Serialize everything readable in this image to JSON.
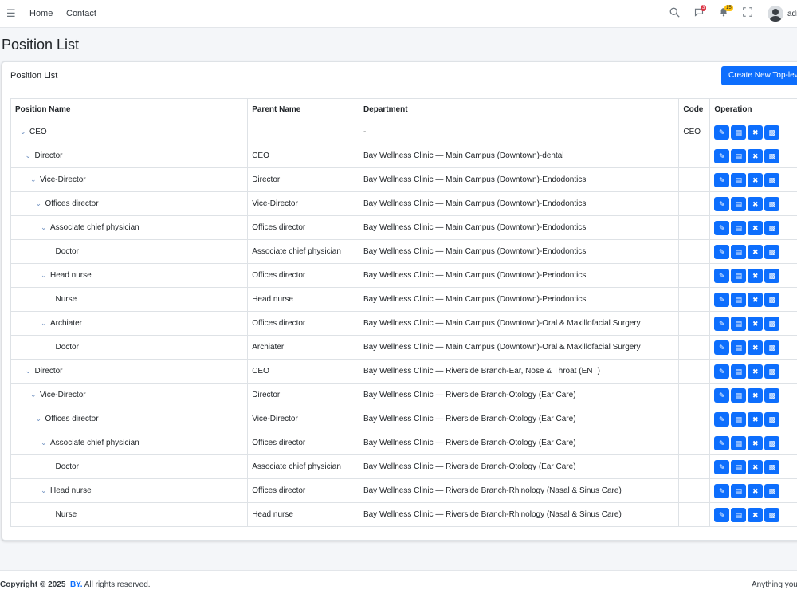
{
  "topbar": {
    "nav": [
      {
        "label": "Home"
      },
      {
        "label": "Contact"
      }
    ],
    "messages_badge": "3",
    "notifications_badge": "15",
    "username": "adr"
  },
  "page": {
    "title": "Position List"
  },
  "card": {
    "title": "Position List",
    "create_button": "Create New Top-level"
  },
  "table": {
    "headers": [
      "Position Name",
      "Parent Name",
      "Department",
      "Code",
      "Operation"
    ],
    "rows": [
      {
        "name": "CEO",
        "level": 0,
        "expanded": true,
        "parent": "",
        "department": "-",
        "code": "CEO"
      },
      {
        "name": "Director",
        "level": 1,
        "expanded": true,
        "parent": "CEO",
        "department": "Bay Wellness Clinic — Main Campus (Downtown)-dental",
        "code": ""
      },
      {
        "name": "Vice-Director",
        "level": 2,
        "expanded": true,
        "parent": "Director",
        "department": "Bay Wellness Clinic — Main Campus (Downtown)-Endodontics",
        "code": ""
      },
      {
        "name": "Offices director",
        "level": 3,
        "expanded": true,
        "parent": "Vice-Director",
        "department": "Bay Wellness Clinic — Main Campus (Downtown)-Endodontics",
        "code": ""
      },
      {
        "name": "Associate chief physician",
        "level": 4,
        "expanded": true,
        "parent": "Offices director",
        "department": "Bay Wellness Clinic — Main Campus (Downtown)-Endodontics",
        "code": ""
      },
      {
        "name": "Doctor",
        "level": 5,
        "expanded": false,
        "parent": "Associate chief physician",
        "department": "Bay Wellness Clinic — Main Campus (Downtown)-Endodontics",
        "code": ""
      },
      {
        "name": "Head nurse",
        "level": 4,
        "expanded": true,
        "parent": "Offices director",
        "department": "Bay Wellness Clinic — Main Campus (Downtown)-Periodontics",
        "code": ""
      },
      {
        "name": "Nurse",
        "level": 5,
        "expanded": false,
        "parent": "Head nurse",
        "department": "Bay Wellness Clinic — Main Campus (Downtown)-Periodontics",
        "code": ""
      },
      {
        "name": "Archiater",
        "level": 4,
        "expanded": true,
        "parent": "Offices director",
        "department": "Bay Wellness Clinic — Main Campus (Downtown)-Oral & Maxillofacial Surgery",
        "code": ""
      },
      {
        "name": "Doctor",
        "level": 5,
        "expanded": false,
        "parent": "Archiater",
        "department": "Bay Wellness Clinic — Main Campus (Downtown)-Oral & Maxillofacial Surgery",
        "code": ""
      },
      {
        "name": "Director",
        "level": 1,
        "expanded": true,
        "parent": "CEO",
        "department": "Bay Wellness Clinic — Riverside Branch-Ear, Nose & Throat (ENT)",
        "code": ""
      },
      {
        "name": "Vice-Director",
        "level": 2,
        "expanded": true,
        "parent": "Director",
        "department": "Bay Wellness Clinic — Riverside Branch-Otology (Ear Care)",
        "code": ""
      },
      {
        "name": "Offices director",
        "level": 3,
        "expanded": true,
        "parent": "Vice-Director",
        "department": "Bay Wellness Clinic — Riverside Branch-Otology (Ear Care)",
        "code": ""
      },
      {
        "name": "Associate chief physician",
        "level": 4,
        "expanded": true,
        "parent": "Offices director",
        "department": "Bay Wellness Clinic — Riverside Branch-Otology (Ear Care)",
        "code": ""
      },
      {
        "name": "Doctor",
        "level": 5,
        "expanded": false,
        "parent": "Associate chief physician",
        "department": "Bay Wellness Clinic — Riverside Branch-Otology (Ear Care)",
        "code": ""
      },
      {
        "name": "Head nurse",
        "level": 4,
        "expanded": true,
        "parent": "Offices director",
        "department": "Bay Wellness Clinic — Riverside Branch-Rhinology (Nasal & Sinus Care)",
        "code": ""
      },
      {
        "name": "Nurse",
        "level": 5,
        "expanded": false,
        "parent": "Head nurse",
        "department": "Bay Wellness Clinic — Riverside Branch-Rhinology (Nasal & Sinus Care)",
        "code": ""
      }
    ],
    "operation_icons": [
      "edit-icon",
      "document-icon",
      "trash-icon",
      "file-icon"
    ]
  },
  "footer": {
    "copyright_prefix": "Copyright © 2025",
    "brand": "BY.",
    "copyright_suffix": "All rights reserved.",
    "right_text": "Anything you"
  },
  "colors": {
    "primary": "#0d6efd",
    "badge_red": "#dc3545",
    "badge_yellow": "#ffc107"
  }
}
